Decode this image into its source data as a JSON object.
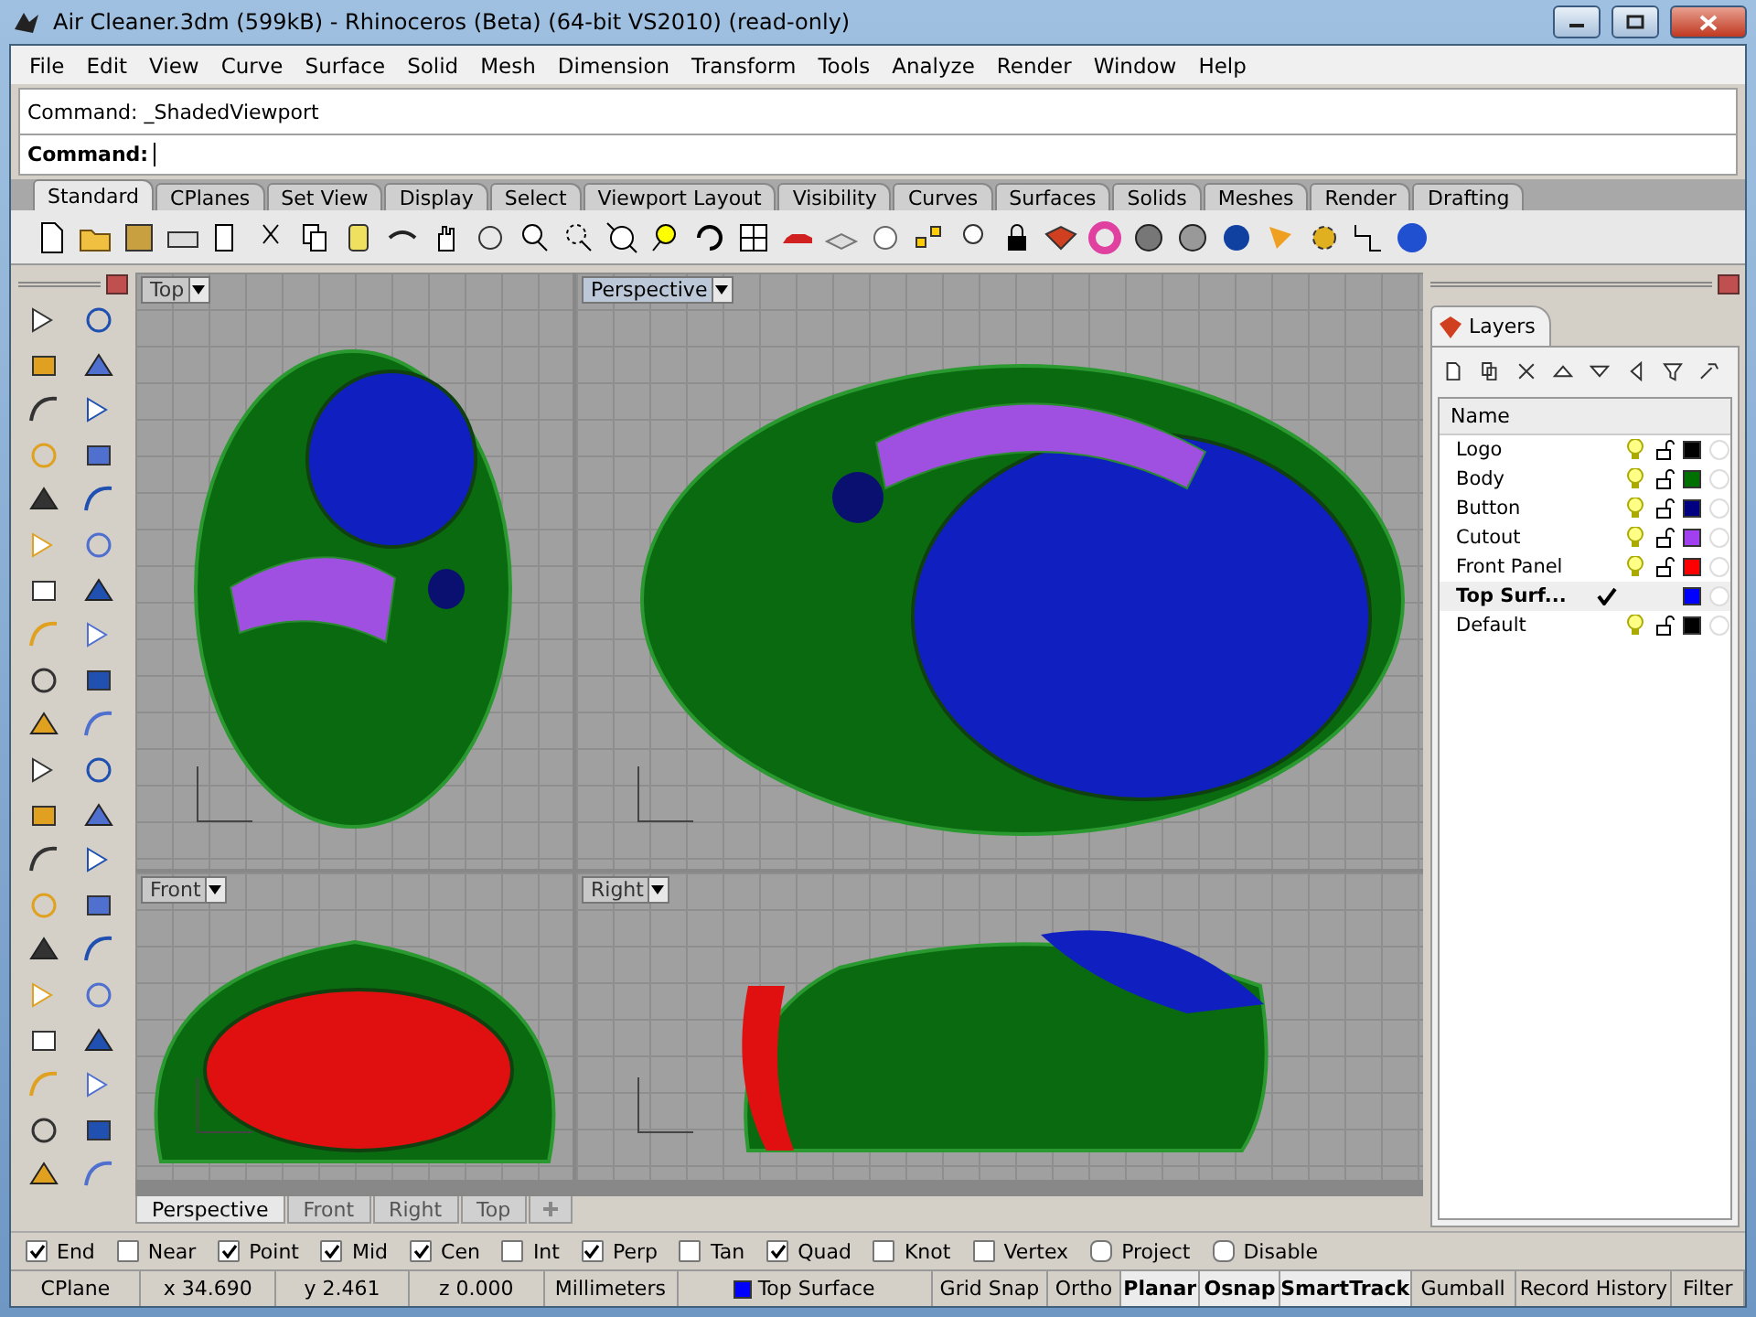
{
  "window": {
    "title": "Air Cleaner.3dm (599kB) - Rhinoceros (Beta) (64-bit VS2010) (read-only)"
  },
  "menu": [
    "File",
    "Edit",
    "View",
    "Curve",
    "Surface",
    "Solid",
    "Mesh",
    "Dimension",
    "Transform",
    "Tools",
    "Analyze",
    "Render",
    "Window",
    "Help"
  ],
  "command": {
    "history": "Command: _ShadedViewport",
    "prompt": "Command:"
  },
  "toolbar_tabs": [
    {
      "label": "Standard",
      "selected": true
    },
    {
      "label": "CPlanes",
      "selected": false
    },
    {
      "label": "Set View",
      "selected": false
    },
    {
      "label": "Display",
      "selected": false
    },
    {
      "label": "Select",
      "selected": false
    },
    {
      "label": "Viewport Layout",
      "selected": false
    },
    {
      "label": "Visibility",
      "selected": false
    },
    {
      "label": "Curves",
      "selected": false
    },
    {
      "label": "Surfaces",
      "selected": false
    },
    {
      "label": "Solids",
      "selected": false
    },
    {
      "label": "Meshes",
      "selected": false
    },
    {
      "label": "Render",
      "selected": false
    },
    {
      "label": "Drafting",
      "selected": false
    }
  ],
  "viewports": [
    {
      "title": "Top",
      "selected": false,
      "kind": "top"
    },
    {
      "title": "Perspective",
      "selected": true,
      "kind": "perspective"
    },
    {
      "title": "Front",
      "selected": false,
      "kind": "front"
    },
    {
      "title": "Right",
      "selected": false,
      "kind": "right"
    }
  ],
  "viewport_tabs": [
    {
      "label": "Perspective",
      "selected": true
    },
    {
      "label": "Front",
      "selected": false
    },
    {
      "label": "Right",
      "selected": false
    },
    {
      "label": "Top",
      "selected": false
    }
  ],
  "layers": {
    "title": "Layers",
    "column": "Name",
    "rows": [
      {
        "name": "Logo",
        "current": false,
        "color": "#000000"
      },
      {
        "name": "Body",
        "current": false,
        "color": "#007000"
      },
      {
        "name": "Button",
        "current": false,
        "color": "#000080"
      },
      {
        "name": "Cutout",
        "current": false,
        "color": "#a040f0"
      },
      {
        "name": "Front Panel",
        "current": false,
        "color": "#ff0000"
      },
      {
        "name": "Top Surf...",
        "current": true,
        "color": "#0000ff"
      },
      {
        "name": "Default",
        "current": false,
        "color": "#000000"
      }
    ]
  },
  "osnaps": [
    {
      "label": "End",
      "checked": true,
      "kind": "checkbox"
    },
    {
      "label": "Near",
      "checked": false,
      "kind": "checkbox"
    },
    {
      "label": "Point",
      "checked": true,
      "kind": "checkbox"
    },
    {
      "label": "Mid",
      "checked": true,
      "kind": "checkbox"
    },
    {
      "label": "Cen",
      "checked": true,
      "kind": "checkbox"
    },
    {
      "label": "Int",
      "checked": false,
      "kind": "checkbox"
    },
    {
      "label": "Perp",
      "checked": true,
      "kind": "checkbox"
    },
    {
      "label": "Tan",
      "checked": false,
      "kind": "checkbox"
    },
    {
      "label": "Quad",
      "checked": true,
      "kind": "checkbox"
    },
    {
      "label": "Knot",
      "checked": false,
      "kind": "checkbox"
    },
    {
      "label": "Vertex",
      "checked": false,
      "kind": "checkbox"
    },
    {
      "label": "Project",
      "checked": false,
      "kind": "toggle"
    },
    {
      "label": "Disable",
      "checked": false,
      "kind": "toggle"
    }
  ],
  "status": {
    "cplane": "CPlane",
    "x": "x 34.690",
    "y": "y 2.461",
    "z": "z 0.000",
    "units": "Millimeters",
    "layer": {
      "name": "Top Surface",
      "color": "#0000ff"
    },
    "toggles": [
      {
        "label": "Grid Snap",
        "on": false
      },
      {
        "label": "Ortho",
        "on": false
      },
      {
        "label": "Planar",
        "on": true
      },
      {
        "label": "Osnap",
        "on": true
      },
      {
        "label": "SmartTrack",
        "on": true
      },
      {
        "label": "Gumball",
        "on": false
      },
      {
        "label": "Record History",
        "on": false
      },
      {
        "label": "Filter",
        "on": false
      }
    ]
  }
}
